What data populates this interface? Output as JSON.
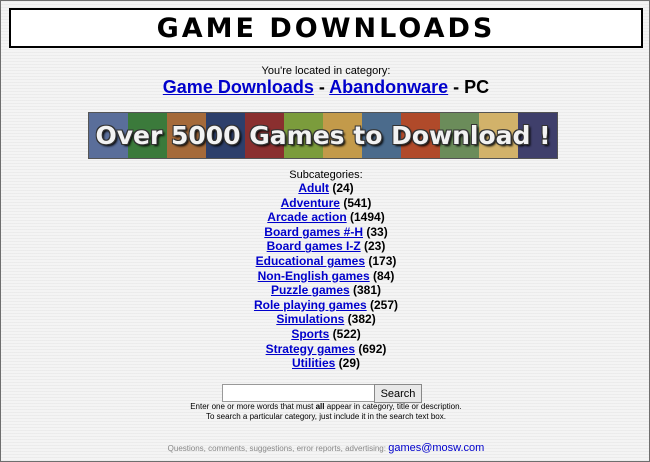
{
  "header": {
    "title": "GAME DOWNLOADS"
  },
  "location": {
    "label": "You're located in category:",
    "crumb1": "Game Downloads",
    "sep1": " - ",
    "crumb2": "Abandonware",
    "sep2": " - PC"
  },
  "banner": {
    "text": "Over 5000 Games to Download !",
    "tile_colors": [
      "#5a6e9a",
      "#3b7a3b",
      "#a56a3a",
      "#2d3f6b",
      "#8a2f2f",
      "#7b9c3c",
      "#c39a4a",
      "#4b6b8c",
      "#b04a2a",
      "#6b8c5a",
      "#d2b26a",
      "#3f3f6b"
    ]
  },
  "subcategories": {
    "label": "Subcategories:",
    "items": [
      {
        "name": "Adult",
        "count": "(24)"
      },
      {
        "name": "Adventure",
        "count": "(541)"
      },
      {
        "name": "Arcade action",
        "count": "(1494)"
      },
      {
        "name": "Board games #-H",
        "count": "(33)"
      },
      {
        "name": "Board games I-Z",
        "count": "(23)"
      },
      {
        "name": "Educational games",
        "count": "(173)"
      },
      {
        "name": "Non-English games",
        "count": "(84)"
      },
      {
        "name": "Puzzle games",
        "count": "(381)"
      },
      {
        "name": "Role playing games",
        "count": "(257)"
      },
      {
        "name": "Simulations",
        "count": "(382)"
      },
      {
        "name": "Sports",
        "count": "(522)"
      },
      {
        "name": "Strategy games",
        "count": "(692)"
      },
      {
        "name": "Utilities",
        "count": "(29)"
      }
    ]
  },
  "search": {
    "value": "",
    "button_label": "Search",
    "help_line1_a": "Enter one or more words that must ",
    "help_line1_b": "all",
    "help_line1_c": " appear in category, title or description.",
    "help_line2": "To search a particular category, just include it in the search text box."
  },
  "footer": {
    "text": "Questions, comments, suggestions, error reports, advertising: ",
    "email": "games@mosw.com"
  },
  "colors": {
    "link": "#0000cc",
    "background": "#f4f4f4"
  }
}
